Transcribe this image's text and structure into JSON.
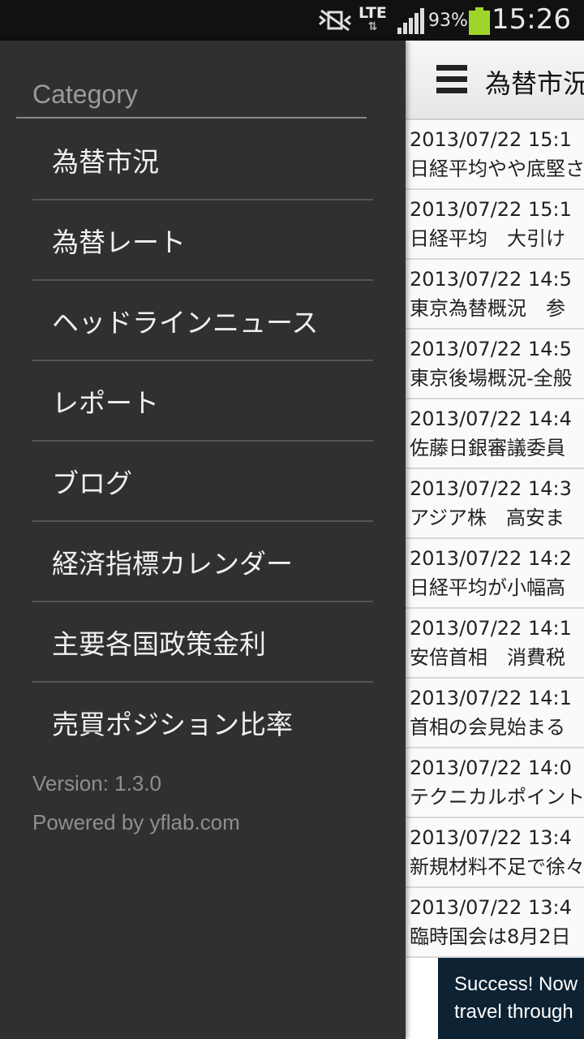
{
  "status_bar": {
    "network": "LTE",
    "battery_percent": "93%",
    "time": "15:26",
    "icons": [
      "vibrate-off-icon",
      "lte-data-icon",
      "signal-icon",
      "battery-icon"
    ],
    "battery_color": "#9fd52a"
  },
  "drawer": {
    "heading": "Category",
    "items": [
      {
        "label": "為替市況"
      },
      {
        "label": "為替レート"
      },
      {
        "label": "ヘッドラインニュース"
      },
      {
        "label": "レポート"
      },
      {
        "label": "ブログ"
      },
      {
        "label": "経済指標カレンダー"
      },
      {
        "label": "主要各国政策金利"
      },
      {
        "label": "売買ポジション比率"
      }
    ],
    "version": "Version: 1.3.0",
    "powered_by": "Powered by yflab.com"
  },
  "action_bar": {
    "menu_icon": "hamburger-icon",
    "title": "為替市況"
  },
  "news": [
    {
      "date": "2013/07/22 15:1",
      "headline": "日経平均やや底堅さ"
    },
    {
      "date": "2013/07/22 15:1",
      "headline": "日経平均　大引け"
    },
    {
      "date": "2013/07/22 14:5",
      "headline": "東京為替概況　参"
    },
    {
      "date": "2013/07/22 14:5",
      "headline": "東京後場概況-全般"
    },
    {
      "date": "2013/07/22 14:4",
      "headline": "佐藤日銀審議委員"
    },
    {
      "date": "2013/07/22 14:3",
      "headline": "アジア株　高安ま"
    },
    {
      "date": "2013/07/22 14:2",
      "headline": "日経平均が小幅高"
    },
    {
      "date": "2013/07/22 14:1",
      "headline": "安倍首相　消費税"
    },
    {
      "date": "2013/07/22 14:1",
      "headline": "首相の会見始まる"
    },
    {
      "date": "2013/07/22 14:0",
      "headline": "テクニカルポイント"
    },
    {
      "date": "2013/07/22 13:4",
      "headline": "新規材料不足で徐々"
    },
    {
      "date": "2013/07/22 13:4",
      "headline": "臨時国会は8月2日"
    }
  ],
  "ad": {
    "line1": "Success! Now",
    "line2": "travel through"
  },
  "colors": {
    "drawer_bg": "#303030",
    "statusbar_bg": "#111111",
    "content_bg": "#ffffff"
  }
}
